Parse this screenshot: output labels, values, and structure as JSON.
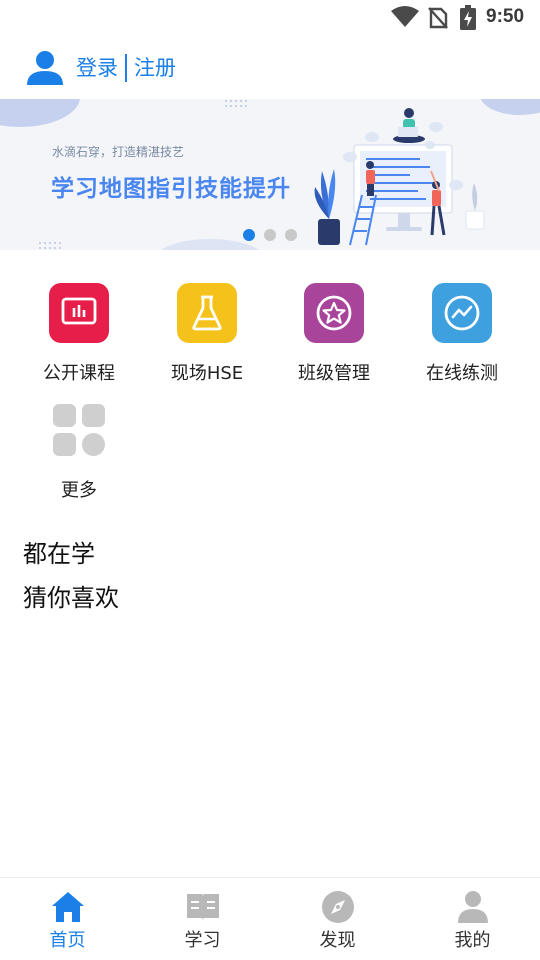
{
  "status_bar": {
    "time": "9:50"
  },
  "header": {
    "login_label": "登录",
    "register_label": "注册"
  },
  "banner": {
    "subtitle": "水滴石穿，打造精湛技艺",
    "title": "学习地图指引技能提升",
    "slide_count": 3,
    "active_slide": 1
  },
  "features": [
    {
      "label": "公开课程",
      "color": "#e81e4a",
      "icon": "bar-chart-icon"
    },
    {
      "label": "现场HSE",
      "color": "#f5c21b",
      "icon": "flask-icon"
    },
    {
      "label": "班级管理",
      "color": "#a8459a",
      "icon": "star-icon"
    },
    {
      "label": "在线练测",
      "color": "#3fa0e0",
      "icon": "trend-icon"
    },
    {
      "label": "更多",
      "color": "#cfcfcf",
      "icon": "grid-icon"
    }
  ],
  "sections": {
    "all_learning": "都在学",
    "recommend": "猜你喜欢"
  },
  "bottom_nav": [
    {
      "label": "首页",
      "icon": "home-icon",
      "active": true
    },
    {
      "label": "学习",
      "icon": "book-icon",
      "active": false
    },
    {
      "label": "发现",
      "icon": "compass-icon",
      "active": false
    },
    {
      "label": "我的",
      "icon": "user-icon",
      "active": false
    }
  ],
  "colors": {
    "accent": "#1a7fe6",
    "inactive": "#b8b8b8"
  }
}
